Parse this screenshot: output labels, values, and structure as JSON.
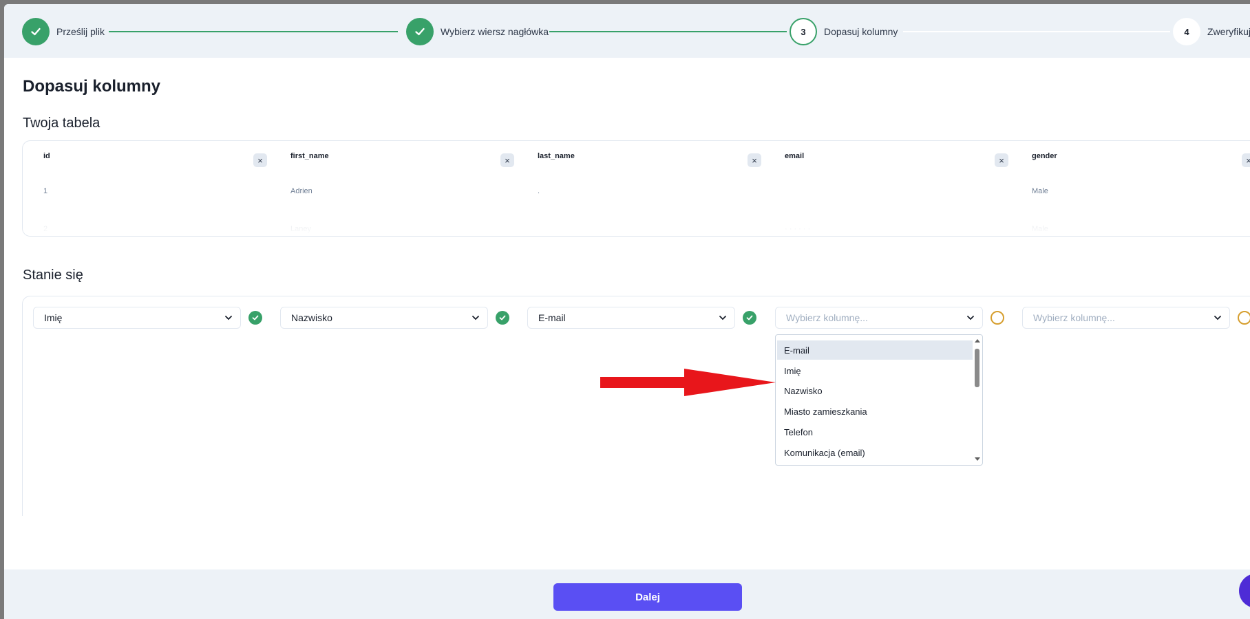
{
  "stepper": {
    "steps": [
      {
        "label": "Prześlij plik",
        "status": "done",
        "number": "1"
      },
      {
        "label": "Wybierz wiersz nagłówka",
        "status": "done",
        "number": "2"
      },
      {
        "label": "Dopasuj kolumny",
        "status": "active",
        "number": "3"
      },
      {
        "label": "Zweryfikuj",
        "status": "todo",
        "number": "4"
      }
    ]
  },
  "page": {
    "title": "Dopasuj kolumny",
    "source_section_title": "Twoja tabela",
    "target_section_title": "Stanie się"
  },
  "source_table": {
    "columns": [
      {
        "header": "id",
        "rows": [
          "1",
          "2"
        ]
      },
      {
        "header": "first_name",
        "rows": [
          "Adrien",
          "Laney"
        ]
      },
      {
        "header": "last_name",
        "rows": [
          ".",
          ""
        ]
      },
      {
        "header": "email",
        "rows": [
          "",
          "· · · · · ·"
        ]
      },
      {
        "header": "gender",
        "rows": [
          "Male",
          "Male"
        ]
      }
    ],
    "remove_icon": "×"
  },
  "mapping": {
    "selects": [
      {
        "value": "Imię",
        "placeholder": false,
        "status": "matched"
      },
      {
        "value": "Nazwisko",
        "placeholder": false,
        "status": "matched"
      },
      {
        "value": "E-mail",
        "placeholder": false,
        "status": "matched"
      },
      {
        "value": "Wybierz kolumnę...",
        "placeholder": true,
        "status": "pending"
      },
      {
        "value": "Wybierz kolumnę...",
        "placeholder": true,
        "status": "pending"
      }
    ],
    "dropdown_options": [
      "E-mail",
      "Imię",
      "Nazwisko",
      "Miasto zamieszkania",
      "Telefon",
      "Komunikacja (email)"
    ],
    "highlighted_option": "E-mail"
  },
  "footer": {
    "next_label": "Dalej"
  },
  "colors": {
    "success": "#38a169",
    "pending": "#d69e2e",
    "primary": "#5a4ff3",
    "annotation_arrow": "#e8161b"
  }
}
